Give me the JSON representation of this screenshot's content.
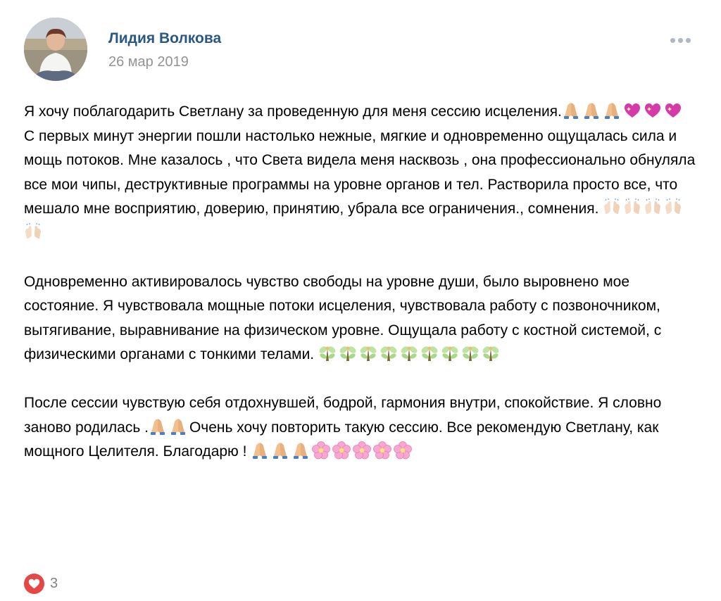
{
  "post": {
    "author": "Лидия Волкова",
    "date": "26 мар 2019",
    "more_icon": "more-horizontal-icon",
    "likes_count": "3",
    "like_icon": "heart-icon",
    "colors": {
      "author": "#2a5885",
      "date": "#939393",
      "like": "#e64646"
    },
    "paragraphs": [
      [
        {
          "t": "Я хочу поблагодарить Светлану за проведенную для меня сессию исцеления."
        },
        {
          "e": "folded-hands"
        },
        {
          "e": "folded-hands"
        },
        {
          "e": "folded-hands"
        },
        {
          "e": "sparkling-heart"
        },
        {
          "e": "sparkling-heart"
        },
        {
          "e": "sparkling-heart"
        },
        {
          "t": " С первых минут энергии пошли настолько нежные, мягкие и одновременно ощущалась сила и мощь потоков. Мне казалось , что Света видела меня насквозь , она профессионально обнуляла все мои чипы, деструктивные программы на уровне органов и тел. Растворила просто все, что мешало мне восприятию, доверию, принятию, убрала все ограничения., сомнения. "
        },
        {
          "e": "raising-hands"
        },
        {
          "e": "raising-hands"
        },
        {
          "e": "raising-hands"
        },
        {
          "e": "raising-hands"
        },
        {
          "e": "raising-hands"
        }
      ],
      [
        {
          "t": "Одновременно активировалось чувство свободы на уровне души, было выровнено мое состояние. Я чувствовала мощные потоки исцеления, чувствовала работу с позвоночником, вытягивание, выравнивание на физическом уровне. Ощущала работу с костной системой, с физическими органами с тонкими телами. "
        },
        {
          "e": "fairy"
        },
        {
          "e": "fairy"
        },
        {
          "e": "fairy"
        },
        {
          "e": "fairy"
        },
        {
          "e": "fairy"
        },
        {
          "e": "fairy"
        },
        {
          "e": "fairy"
        },
        {
          "e": "fairy"
        },
        {
          "e": "fairy"
        }
      ],
      [
        {
          "t": "После сессии чувствую себя отдохнувшей, бодрой, гармония внутри, спокойствие. Я словно заново родилась ."
        },
        {
          "e": "folded-hands"
        },
        {
          "e": "folded-hands"
        },
        {
          "t": "Очень хочу повторить такую сессию. Все рекомендую Светлану, как мощного Целителя. Благодарю ! "
        },
        {
          "e": "folded-hands"
        },
        {
          "e": "folded-hands"
        },
        {
          "e": "folded-hands"
        },
        {
          "e": "cherry-blossom"
        },
        {
          "e": "cherry-blossom"
        },
        {
          "e": "cherry-blossom"
        },
        {
          "e": "cherry-blossom"
        },
        {
          "e": "cherry-blossom"
        }
      ]
    ]
  }
}
